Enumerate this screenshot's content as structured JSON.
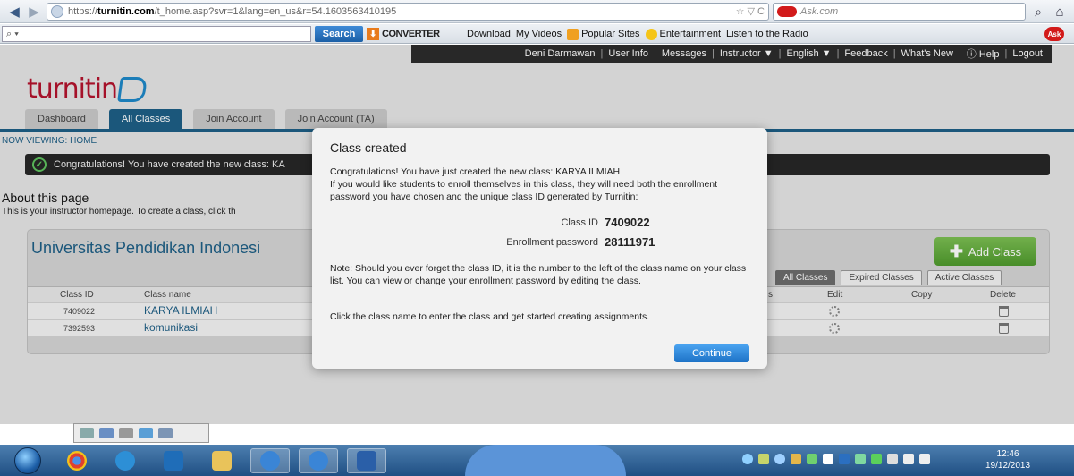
{
  "browser": {
    "url_prefix": "https://",
    "url_host": "turnitin.com",
    "url_path": "/t_home.asp?svr=1&lang=en_us&r=54.1603563410195",
    "search_engine_placeholder": "Ask.com",
    "nav_back": "◀",
    "nav_forward": "▶",
    "url_end_icons": "☆ ▽ C"
  },
  "toolbar": {
    "search_label": "Search",
    "search_input_glyph": "⌕ ▾",
    "converter_label": "CONVERTER",
    "links": [
      "Download",
      "My Videos",
      "Popular Sites",
      "Entertainment",
      "Listen to the Radio"
    ],
    "ask_label": "Ask"
  },
  "userbar": {
    "items": [
      "Deni Darmawan",
      "User Info",
      "Messages",
      "Instructor ▼",
      "English ▼",
      "Feedback",
      "What's New",
      "ⓘ Help",
      "Logout"
    ]
  },
  "logo": {
    "text": "turnitin"
  },
  "tabs": [
    {
      "label": "Dashboard"
    },
    {
      "label": "All Classes"
    },
    {
      "label": "Join Account"
    },
    {
      "label": "Join Account (TA)"
    }
  ],
  "now_viewing": "NOW VIEWING: HOME",
  "congrats_bar": "Congratulations! You have created the new class: KA",
  "about": {
    "title": "About this page",
    "text": "This is your instructor homepage. To create a class, click th"
  },
  "class_panel": {
    "title": "Universitas Pendidikan Indonesi",
    "add_class": "Add Class",
    "filter_tabs": [
      "All Classes",
      "Expired Classes",
      "Active Classes"
    ],
    "columns": [
      "Class ID",
      "Class name",
      "s",
      "Edit",
      "Copy",
      "Delete"
    ],
    "rows": [
      {
        "id": "7409022",
        "name": "KARYA ILMIAH"
      },
      {
        "id": "7392593",
        "name": "komunikasi"
      }
    ]
  },
  "modal": {
    "title": "Class created",
    "message_line1": "Congratulations! You have just created the new class: KARYA ILMIAH",
    "message_line2": "If you would like students to enroll themselves in this class, they will need both the enrollment password you have chosen and the unique class ID generated by Turnitin:",
    "class_id_label": "Class ID",
    "class_id_value": "7409022",
    "password_label": "Enrollment password",
    "password_value": "28111971",
    "note": "Note: Should you ever forget the class ID, it is the number to the left of the class name on your class list. You can view or change your enrollment password by editing the class.",
    "tip": "Click the class name to enter the class and get started creating assignments.",
    "continue_label": "Continue"
  },
  "taskbar": {
    "time": "12:46",
    "date": "19/12/2013"
  },
  "colors": {
    "brand_red": "#b3132d",
    "brand_blue": "#1e5f86",
    "add_green": "#5faa38",
    "continue_blue": "#2a86da"
  }
}
